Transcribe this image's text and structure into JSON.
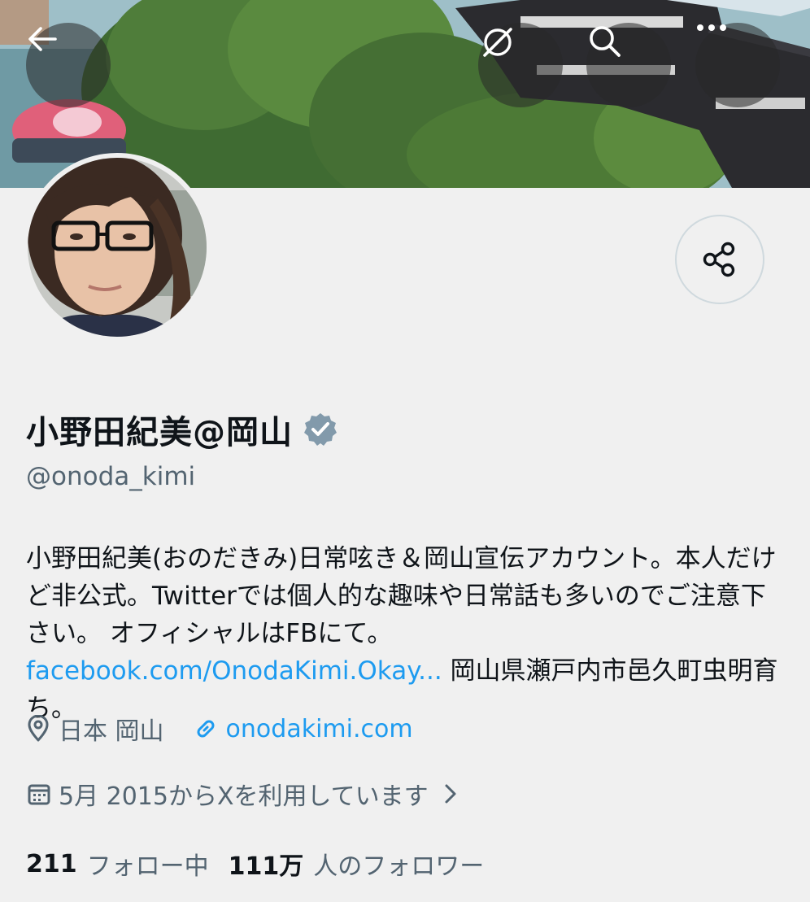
{
  "profile": {
    "display_name": "小野田紀美@岡山",
    "handle": "@onoda_kimi",
    "bio_text_1": "小野田紀美(おのだきみ)日常呟き＆岡山宣伝アカウント。本人だけど非公式。Twitterでは個人的な趣味や日常話も多いのでご注意下さい。 オフィシャルはFBにて。",
    "bio_link": "facebook.com/OnodaKimi.Okay...",
    "bio_text_2": " 岡山県瀬戸内市邑久町虫明育ち。",
    "location": "日本 岡山",
    "website": "onodakimi.com",
    "joined": "5月 2015からXを利用しています",
    "following_count": "211",
    "following_label": "フォロー中",
    "followers_count": "111万",
    "followers_label": "人のフォロワー"
  },
  "icons": {
    "back": "back-arrow-icon",
    "translate": "translate-globe-icon",
    "search": "search-icon",
    "more": "more-dots-icon",
    "share": "share-icon",
    "verified": "verified-badge-icon",
    "location": "location-pin-icon",
    "link": "link-icon",
    "calendar": "calendar-icon",
    "chevron": "chevron-right-icon"
  },
  "colors": {
    "link": "#1d9bf0",
    "secondary_text": "#536471",
    "verified_badge": "#829aab",
    "background": "#f0f0f0"
  }
}
